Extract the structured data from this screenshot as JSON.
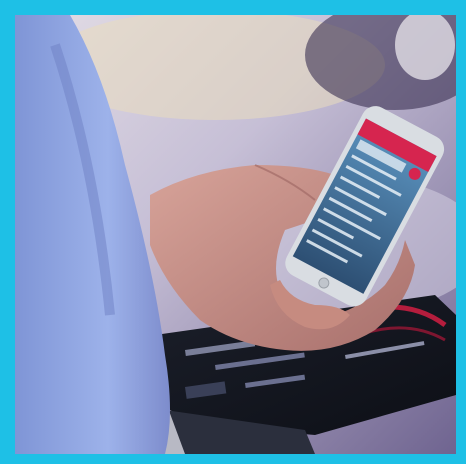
{
  "photo": {
    "subject": "hand-holding-smartphone",
    "colors": {
      "border": "#1ec0e6",
      "app_header": "#d6254f",
      "app_body": "#4a7fa8",
      "sleeve": "#8fa6e0",
      "skin": "#c98f83",
      "brochure": "#151820"
    },
    "phone_app": {
      "header_title": "",
      "list_rows": 9
    }
  }
}
